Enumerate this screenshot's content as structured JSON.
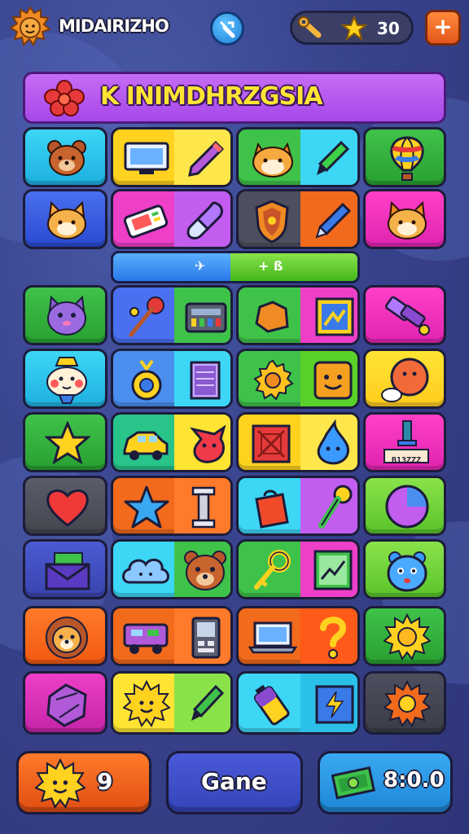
{
  "header": {
    "player_name": "MIDAIRIZHO",
    "currency_value": "30",
    "plus_label": "+"
  },
  "banner": {
    "title": "K INIMDHRZGSIA"
  },
  "progress": {
    "left_label": "✈",
    "right_label": "+ ß",
    "fill_fraction": 0.48
  },
  "board": {
    "row2_label": "B13ZZZ"
  },
  "bottom": {
    "left_value": "9",
    "center_label": "Gane",
    "right_value": "8:0.0"
  },
  "colors": {
    "background": "#3a4590",
    "banner": "#b257ef",
    "title": "#ffe433"
  }
}
